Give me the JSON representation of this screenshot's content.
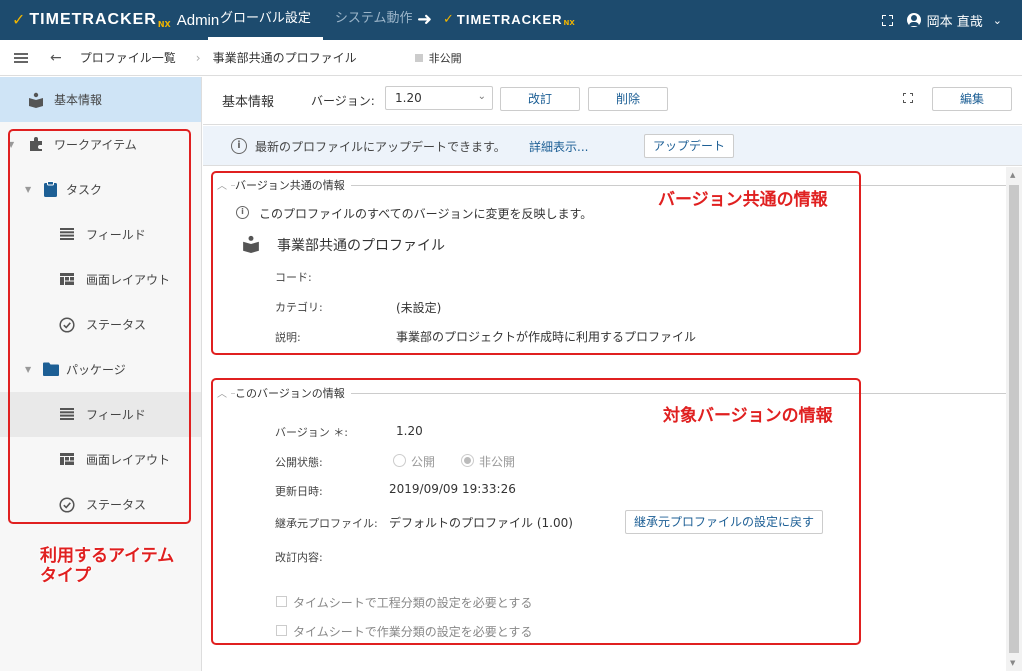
{
  "header": {
    "logo_text": "TIMETRACKER",
    "logo_nx": "NX",
    "admin_label": "Admin",
    "tabs": [
      {
        "label": "グローバル設定",
        "active": true
      },
      {
        "label": "システム動作",
        "active": false
      }
    ],
    "target_logo_text": "TIMETRACKER",
    "target_logo_nx": "NX",
    "user_name": "岡本 直哉"
  },
  "breadcrumb": {
    "items": [
      "プロファイル一覧",
      "事業部共通のプロファイル"
    ],
    "status": "非公開"
  },
  "sidebar": {
    "items": [
      {
        "label": "基本情報"
      },
      {
        "label": "ワークアイテム"
      },
      {
        "label": "タスク"
      },
      {
        "label": "フィールド"
      },
      {
        "label": "画面レイアウト"
      },
      {
        "label": "ステータス"
      },
      {
        "label": "パッケージ"
      },
      {
        "label": "フィールド"
      },
      {
        "label": "画面レイアウト"
      },
      {
        "label": "ステータス"
      }
    ]
  },
  "content_header": {
    "title": "基本情報",
    "version_label": "バージョン:",
    "version_value": "1.20",
    "revise_button": "改訂",
    "delete_button": "削除",
    "edit_button": "編集"
  },
  "banner": {
    "text": "最新のプロファイルにアップデートできます。",
    "link": "詳細表示...",
    "update_button": "アップデート"
  },
  "common_section": {
    "title": "バージョン共通の情報",
    "notice": "このプロファイルのすべてのバージョンに変更を反映します。",
    "profile_name": "事業部共通のプロファイル",
    "code_label": "コード:",
    "category_label": "カテゴリ:",
    "category_value": "(未設定)",
    "desc_label": "説明:",
    "desc_value": "事業部のプロジェクトが作成時に利用するプロファイル"
  },
  "version_section": {
    "title": "このバージョンの情報",
    "version_label": "バージョン ＊:",
    "version_value": "1.20",
    "publish_label": "公開状態:",
    "publish_options": [
      "公開",
      "非公開"
    ],
    "publish_selected": "非公開",
    "updated_label": "更新日時:",
    "updated_value": "2019/09/09 19:33:26",
    "inherit_label": "継承元プロファイル:",
    "inherit_value": "デフォルトのプロファイル (1.00)",
    "inherit_button": "継承元プロファイルの設定に戻す",
    "revision_label": "改訂内容:",
    "checkbox1": "タイムシートで工程分類の設定を必要とする",
    "checkbox2": "タイムシートで作業分類の設定を必要とする"
  },
  "annotations": {
    "common_info": "バージョン共通の情報",
    "version_info": "対象バージョンの情報",
    "item_types_line1": "利用するアイテム",
    "item_types_line2": "タイプ"
  },
  "colors": {
    "header_bg": "#1d4b6e",
    "accent_gold": "#f0b400",
    "link": "#1d5f95",
    "annotation_red": "#e02020",
    "sidebar_active": "#cfe4f6"
  }
}
